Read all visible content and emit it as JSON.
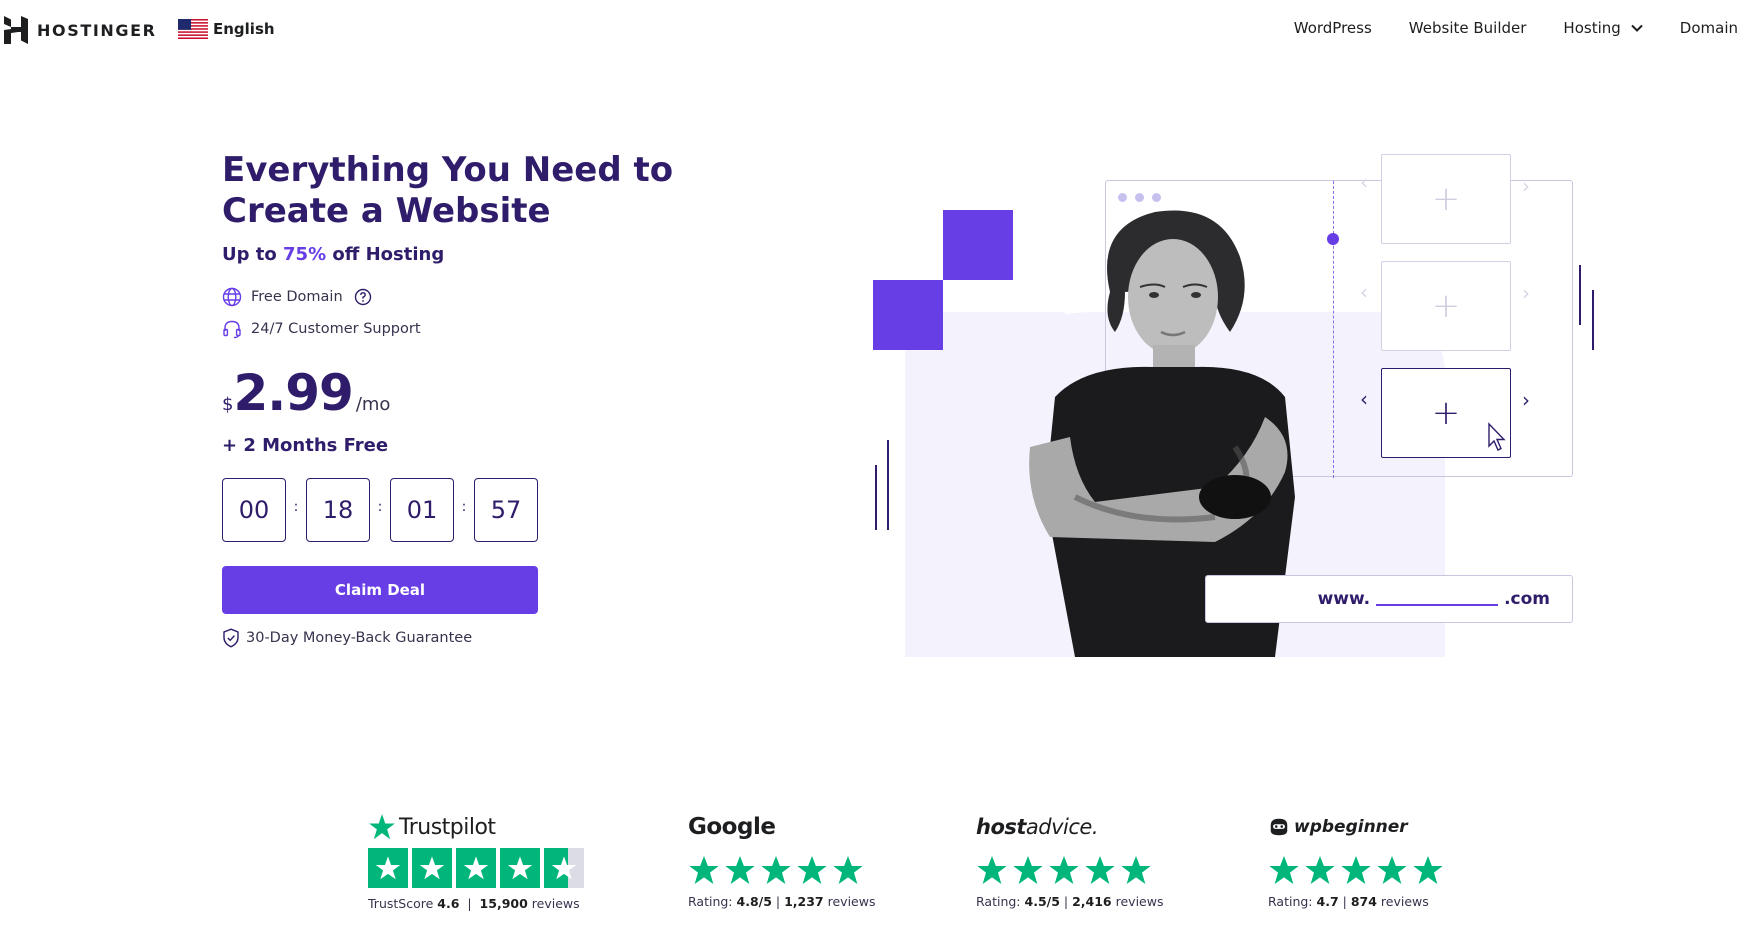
{
  "header": {
    "logo_text": "HOSTINGER",
    "language": "English",
    "nav": [
      {
        "label": "WordPress",
        "has_dropdown": false
      },
      {
        "label": "Website Builder",
        "has_dropdown": false
      },
      {
        "label": "Hosting",
        "has_dropdown": true
      },
      {
        "label": "Domain",
        "has_dropdown": false
      }
    ]
  },
  "hero": {
    "headline_line1": "Everything You Need to",
    "headline_line2": "Create a Website",
    "subhead_prefix": "Up to ",
    "subhead_discount": "75%",
    "subhead_suffix": " off Hosting",
    "features": [
      "Free Domain",
      "24/7 Customer Support"
    ],
    "price_currency": "$",
    "price_amount": "2.99",
    "price_period": "/mo",
    "bonus": "+ 2 Months Free",
    "timer": {
      "hours": "00",
      "minutes": "18",
      "seconds": "01",
      "centis": "57",
      "separator": ":"
    },
    "cta_label": "Claim Deal",
    "guarantee": "30-Day Money-Back Guarantee"
  },
  "illustration": {
    "url_prefix": "www.",
    "url_suffix": ".com",
    "plus_symbol": "+"
  },
  "reviews": [
    {
      "brand": "Trustpilot",
      "score_label": "TrustScore",
      "score": "4.6",
      "count": "15,900",
      "count_label": "reviews",
      "stars": 4.6
    },
    {
      "brand": "Google",
      "rating_label": "Rating:",
      "rating": "4.8/5",
      "count": "1,237",
      "count_label": "reviews",
      "stars": 5
    },
    {
      "brand_bold": "host",
      "brand_rest": "advice.",
      "rating_label": "Rating:",
      "rating": "4.5/5",
      "count": "2,416",
      "count_label": "reviews",
      "stars": 5
    },
    {
      "brand": "wpbeginner",
      "rating_label": "Rating:",
      "rating": "4.7",
      "count": "874",
      "count_label": "reviews",
      "stars": 5
    }
  ],
  "colors": {
    "brand_primary": "#673de6",
    "brand_dark": "#2f1c6a",
    "review_green": "#00b67a"
  }
}
